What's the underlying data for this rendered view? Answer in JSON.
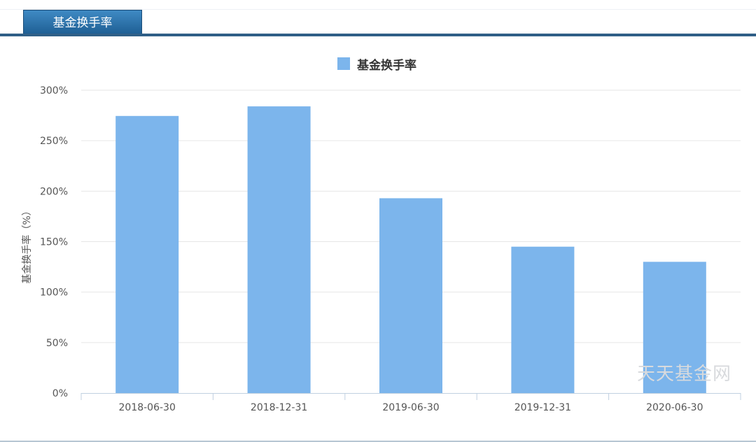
{
  "tab": {
    "label": "基金换手率"
  },
  "watermark": "天天基金网",
  "colors": {
    "bar": "#7cb5ec",
    "tab": "#2f6fa5",
    "grid": "#e6e6e6"
  },
  "chart_data": {
    "type": "bar",
    "categories": [
      "2018-06-30",
      "2018-12-31",
      "2019-06-30",
      "2019-12-31",
      "2020-06-30"
    ],
    "series": [
      {
        "name": "基金换手率",
        "values": [
          274.5,
          284,
          193,
          145,
          130
        ]
      }
    ],
    "ylabel": "基金换手率（%）",
    "ylim": [
      0,
      300
    ],
    "yticks": [
      "0%",
      "50%",
      "100%",
      "150%",
      "200%",
      "250%",
      "300%"
    ],
    "grid": true,
    "legend": "top-center"
  }
}
